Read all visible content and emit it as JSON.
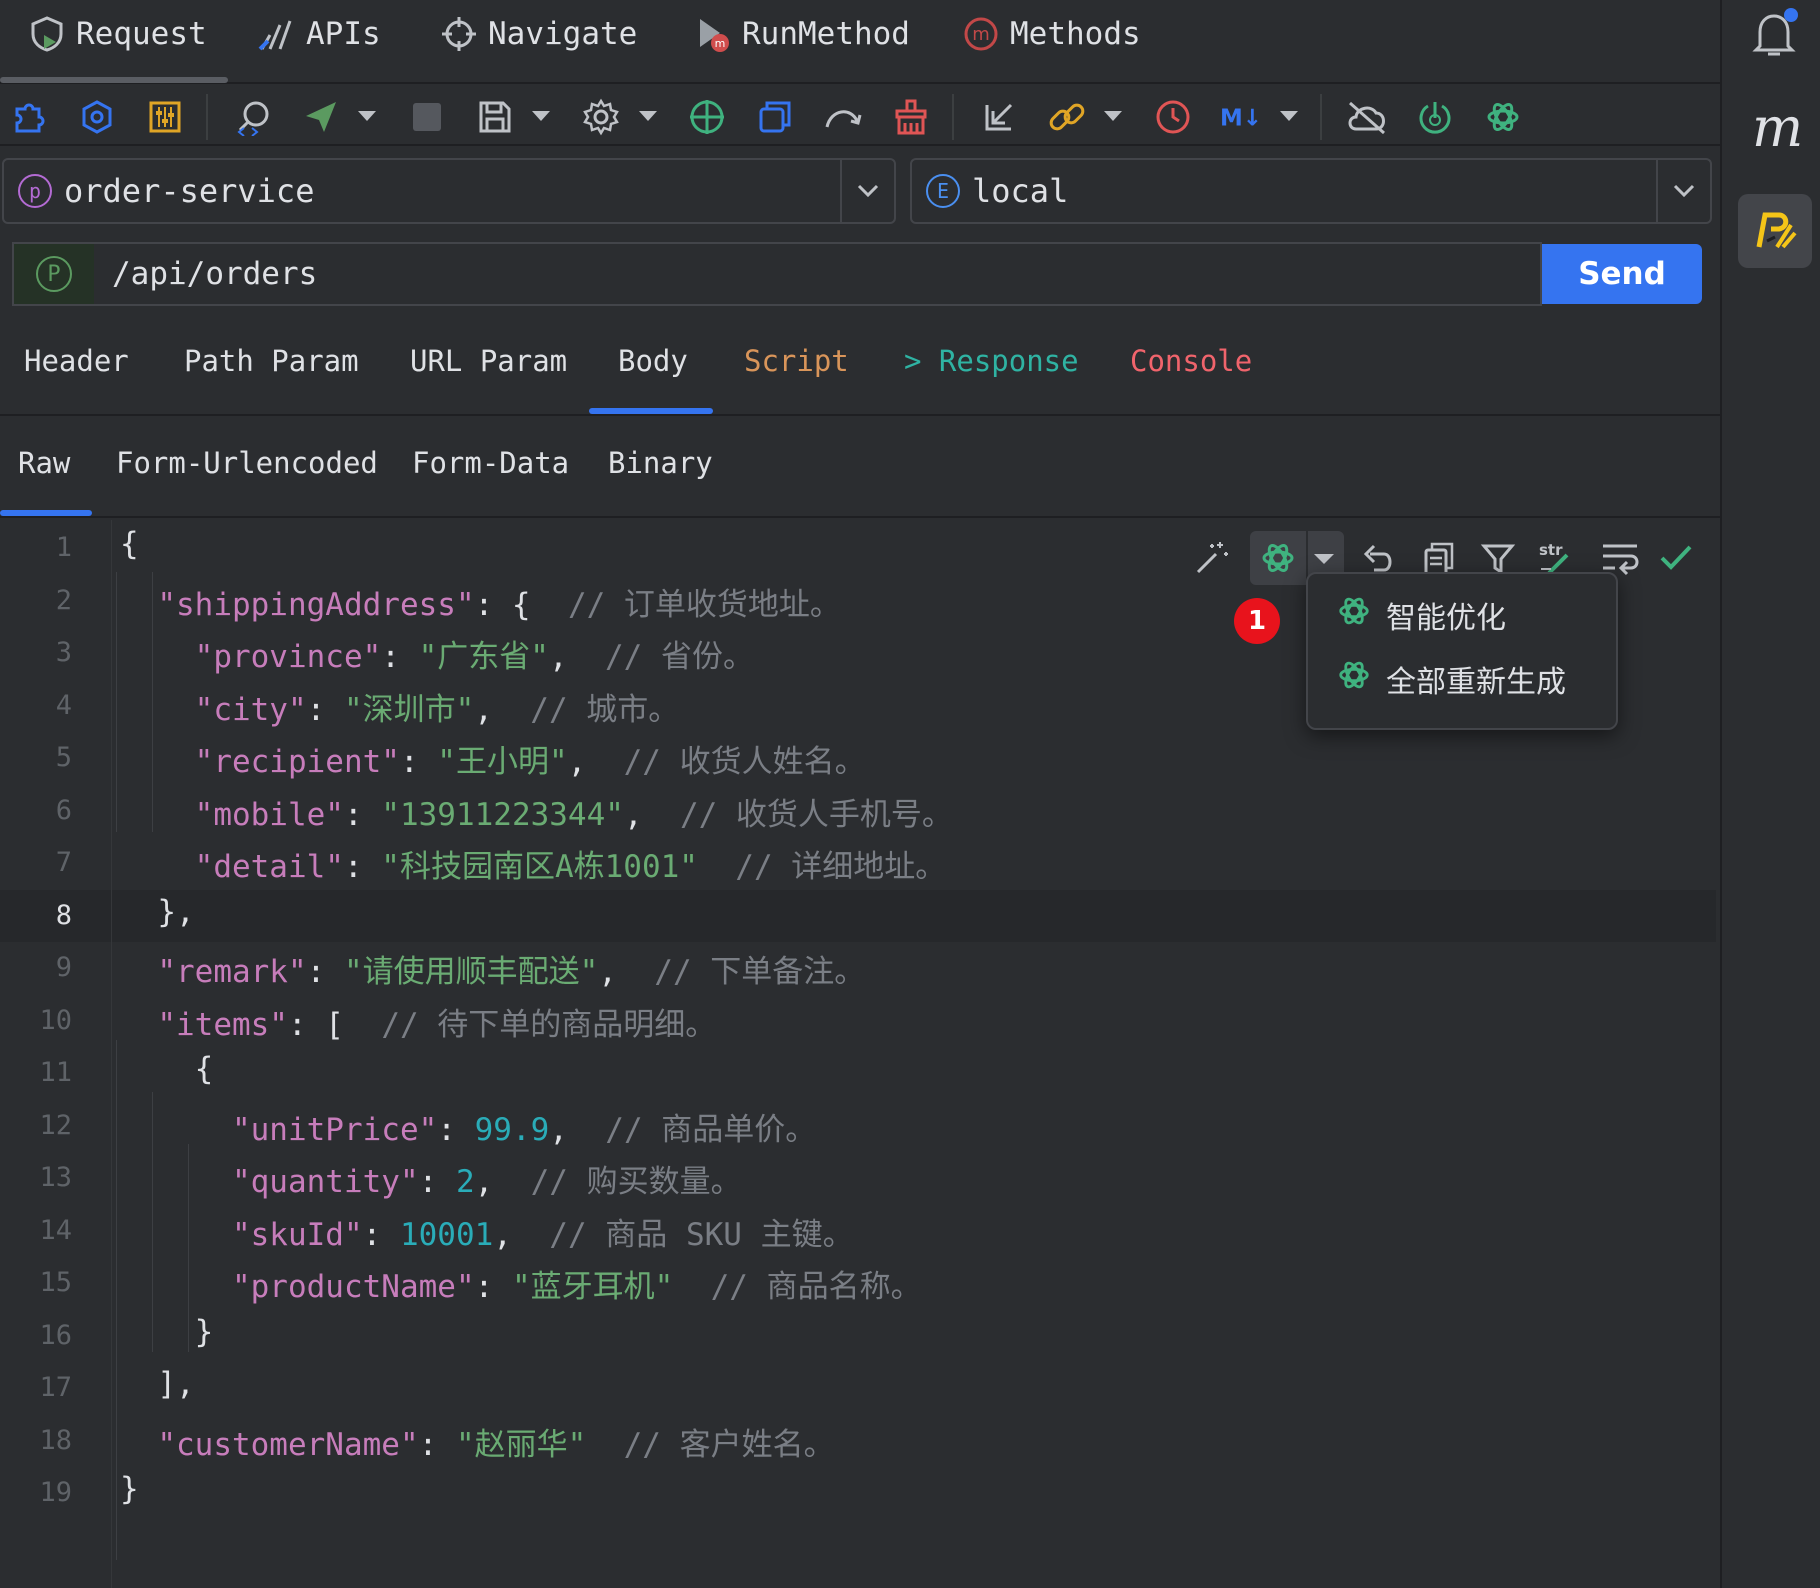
{
  "top_tabs": [
    {
      "label": "Request",
      "icon": "shield-play-icon"
    },
    {
      "label": "APIs",
      "icon": "apis-chart-icon"
    },
    {
      "label": "Navigate",
      "icon": "crosshair-icon"
    },
    {
      "label": "RunMethod",
      "icon": "run-method-icon"
    },
    {
      "label": "Methods",
      "icon": "methods-m-icon"
    }
  ],
  "toolbar_icons": [
    "puzzle-icon",
    "hexagon-icon",
    "sliders-icon",
    "search-code-icon",
    "send-icon",
    "caret",
    "stop-icon",
    "save-icon",
    "caret",
    "gear-icon",
    "caret",
    "target-icon",
    "copy-icon",
    "redo-icon",
    "clean-icon",
    "import-icon",
    "link-icon",
    "caret",
    "clock-icon",
    "markdown-icon",
    "caret",
    "cloud-off-icon",
    "power-icon",
    "openai-icon"
  ],
  "project_select": {
    "badge": "p",
    "value": "order-service"
  },
  "env_select": {
    "badge": "E",
    "value": "local"
  },
  "url": {
    "method_badge": "P",
    "path": "/api/orders",
    "send_label": "Send"
  },
  "request_tabs": [
    {
      "label": "Header",
      "color": "#dfe1e5"
    },
    {
      "label": "Path Param",
      "color": "#dfe1e5"
    },
    {
      "label": "URL Param",
      "color": "#dfe1e5"
    },
    {
      "label": "Body",
      "color": "#dfe1e5",
      "active": true
    },
    {
      "label": "Script",
      "color": "#d9955a"
    },
    {
      "label": "> Response",
      "color": "#2fb3a3"
    },
    {
      "label": "Console",
      "color": "#f0646c"
    }
  ],
  "body_tabs": [
    {
      "label": "Raw",
      "active": true
    },
    {
      "label": "Form-Urlencoded"
    },
    {
      "label": "Form-Data"
    },
    {
      "label": "Binary"
    }
  ],
  "editor": {
    "current_line": 8,
    "lines": [
      {
        "n": "1",
        "tokens": [
          {
            "t": "{",
            "c": ""
          }
        ]
      },
      {
        "n": "2",
        "tokens": [
          {
            "t": "  ",
            "c": ""
          },
          {
            "t": "\"shippingAddress\"",
            "c": "k"
          },
          {
            "t": ": {  ",
            "c": ""
          },
          {
            "t": "// 订单收货地址。",
            "c": "c"
          }
        ]
      },
      {
        "n": "3",
        "tokens": [
          {
            "t": "    ",
            "c": ""
          },
          {
            "t": "\"province\"",
            "c": "k"
          },
          {
            "t": ": ",
            "c": ""
          },
          {
            "t": "\"广东省\"",
            "c": "s"
          },
          {
            "t": ",  ",
            "c": ""
          },
          {
            "t": "// 省份。",
            "c": "c"
          }
        ]
      },
      {
        "n": "4",
        "tokens": [
          {
            "t": "    ",
            "c": ""
          },
          {
            "t": "\"city\"",
            "c": "k"
          },
          {
            "t": ": ",
            "c": ""
          },
          {
            "t": "\"深圳市\"",
            "c": "s"
          },
          {
            "t": ",  ",
            "c": ""
          },
          {
            "t": "// 城市。",
            "c": "c"
          }
        ]
      },
      {
        "n": "5",
        "tokens": [
          {
            "t": "    ",
            "c": ""
          },
          {
            "t": "\"recipient\"",
            "c": "k"
          },
          {
            "t": ": ",
            "c": ""
          },
          {
            "t": "\"王小明\"",
            "c": "s"
          },
          {
            "t": ",  ",
            "c": ""
          },
          {
            "t": "// 收货人姓名。",
            "c": "c"
          }
        ]
      },
      {
        "n": "6",
        "tokens": [
          {
            "t": "    ",
            "c": ""
          },
          {
            "t": "\"mobile\"",
            "c": "k"
          },
          {
            "t": ": ",
            "c": ""
          },
          {
            "t": "\"13911223344\"",
            "c": "s"
          },
          {
            "t": ",  ",
            "c": ""
          },
          {
            "t": "// 收货人手机号。",
            "c": "c"
          }
        ]
      },
      {
        "n": "7",
        "tokens": [
          {
            "t": "    ",
            "c": ""
          },
          {
            "t": "\"detail\"",
            "c": "k"
          },
          {
            "t": ": ",
            "c": ""
          },
          {
            "t": "\"科技园南区A栋1001\"",
            "c": "s"
          },
          {
            "t": "  ",
            "c": ""
          },
          {
            "t": "// 详细地址。",
            "c": "c"
          }
        ]
      },
      {
        "n": "8",
        "tokens": [
          {
            "t": "  },",
            "c": ""
          }
        ]
      },
      {
        "n": "9",
        "tokens": [
          {
            "t": "  ",
            "c": ""
          },
          {
            "t": "\"remark\"",
            "c": "k"
          },
          {
            "t": ": ",
            "c": ""
          },
          {
            "t": "\"请使用顺丰配送\"",
            "c": "s"
          },
          {
            "t": ",  ",
            "c": ""
          },
          {
            "t": "// 下单备注。",
            "c": "c"
          }
        ]
      },
      {
        "n": "10",
        "tokens": [
          {
            "t": "  ",
            "c": ""
          },
          {
            "t": "\"items\"",
            "c": "k"
          },
          {
            "t": ": [  ",
            "c": ""
          },
          {
            "t": "// 待下单的商品明细。",
            "c": "c"
          }
        ]
      },
      {
        "n": "11",
        "tokens": [
          {
            "t": "    {",
            "c": ""
          }
        ]
      },
      {
        "n": "12",
        "tokens": [
          {
            "t": "      ",
            "c": ""
          },
          {
            "t": "\"unitPrice\"",
            "c": "k"
          },
          {
            "t": ": ",
            "c": ""
          },
          {
            "t": "99.9",
            "c": "n"
          },
          {
            "t": ",  ",
            "c": ""
          },
          {
            "t": "// 商品单价。",
            "c": "c"
          }
        ]
      },
      {
        "n": "13",
        "tokens": [
          {
            "t": "      ",
            "c": ""
          },
          {
            "t": "\"quantity\"",
            "c": "k"
          },
          {
            "t": ": ",
            "c": ""
          },
          {
            "t": "2",
            "c": "n"
          },
          {
            "t": ",  ",
            "c": ""
          },
          {
            "t": "// 购买数量。",
            "c": "c"
          }
        ]
      },
      {
        "n": "14",
        "tokens": [
          {
            "t": "      ",
            "c": ""
          },
          {
            "t": "\"skuId\"",
            "c": "k"
          },
          {
            "t": ": ",
            "c": ""
          },
          {
            "t": "10001",
            "c": "n"
          },
          {
            "t": ",  ",
            "c": ""
          },
          {
            "t": "// 商品 SKU 主键。",
            "c": "c"
          }
        ]
      },
      {
        "n": "15",
        "tokens": [
          {
            "t": "      ",
            "c": ""
          },
          {
            "t": "\"productName\"",
            "c": "k"
          },
          {
            "t": ": ",
            "c": ""
          },
          {
            "t": "\"蓝牙耳机\"",
            "c": "s"
          },
          {
            "t": "  ",
            "c": ""
          },
          {
            "t": "// 商品名称。",
            "c": "c"
          }
        ]
      },
      {
        "n": "16",
        "tokens": [
          {
            "t": "    }",
            "c": ""
          }
        ]
      },
      {
        "n": "17",
        "tokens": [
          {
            "t": "  ],",
            "c": ""
          }
        ]
      },
      {
        "n": "18",
        "tokens": [
          {
            "t": "  ",
            "c": ""
          },
          {
            "t": "\"customerName\"",
            "c": "k"
          },
          {
            "t": ": ",
            "c": ""
          },
          {
            "t": "\"赵丽华\"",
            "c": "s"
          },
          {
            "t": "  ",
            "c": ""
          },
          {
            "t": "// 客户姓名。",
            "c": "c"
          }
        ]
      },
      {
        "n": "19",
        "tokens": [
          {
            "t": "}",
            "c": ""
          }
        ]
      }
    ]
  },
  "ai_menu": {
    "marker": "1",
    "items": [
      "智能优化",
      "全部重新生成"
    ]
  },
  "colors": {
    "accent": "#3574f0",
    "openai_green": "#3fb27f",
    "marker_red": "#e8131c"
  }
}
